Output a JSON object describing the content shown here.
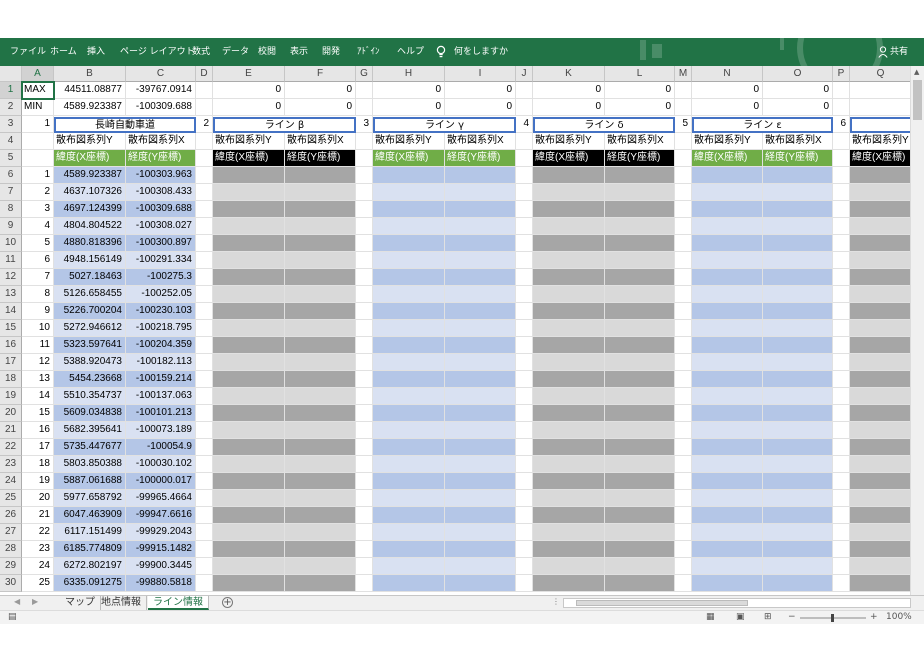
{
  "ribbon": {
    "tabs": [
      "ファイル",
      "ホーム",
      "挿入",
      "ページ レイアウト",
      "数式",
      "データ",
      "校閲",
      "表示",
      "開発",
      "ｱﾄﾞｲﾝ",
      "ヘルプ"
    ],
    "tell_me": "何をしますか",
    "share": "共有",
    "accent": "#217346"
  },
  "grid": {
    "columns": [
      "A",
      "B",
      "C",
      "D",
      "E",
      "F",
      "G",
      "H",
      "I",
      "J",
      "K",
      "L",
      "M",
      "N",
      "O",
      "P",
      "Q"
    ],
    "rows": [
      "1",
      "2",
      "3",
      "4",
      "5",
      "6",
      "7",
      "8",
      "9",
      "10",
      "11",
      "12",
      "13",
      "14",
      "15",
      "16",
      "17",
      "18",
      "19",
      "20",
      "21",
      "22",
      "23",
      "24",
      "25",
      "26",
      "27",
      "28",
      "29",
      "30"
    ],
    "max_row": {
      "label": "MAX",
      "b": "44511.08877",
      "c": "-39767.0914",
      "zeros": [
        "0",
        "0",
        "0",
        "0",
        "0",
        "0",
        "0",
        "0"
      ]
    },
    "min_row": {
      "label": "MIN",
      "b": "4589.923387",
      "c": "-100309.688",
      "zeros": [
        "0",
        "0",
        "0",
        "0",
        "0",
        "0",
        "0",
        "0"
      ]
    },
    "line_groups": [
      {
        "num": "1",
        "title": "長崎自動車道",
        "style": "bold-blue"
      },
      {
        "num": "2",
        "title": "ライン β",
        "style": "dark-grey"
      },
      {
        "num": "3",
        "title": "ライン γ",
        "style": "blue"
      },
      {
        "num": "4",
        "title": "ライン δ",
        "style": "dark-grey"
      },
      {
        "num": "5",
        "title": "ライン ε",
        "style": "blue"
      },
      {
        "num": "6",
        "title": "",
        "style": "dark-grey"
      }
    ],
    "series_y": "散布図系列Y",
    "series_x": "散布図系列X",
    "lat_label": "緯度(X座標)",
    "lon_label": "経度(Y座標)",
    "data_rows": [
      {
        "n": "1",
        "lat": "4589.923387",
        "lon": "-100303.963"
      },
      {
        "n": "2",
        "lat": "4637.107326",
        "lon": "-100308.433"
      },
      {
        "n": "3",
        "lat": "4697.124399",
        "lon": "-100309.688"
      },
      {
        "n": "4",
        "lat": "4804.804522",
        "lon": "-100308.027"
      },
      {
        "n": "5",
        "lat": "4880.818396",
        "lon": "-100300.897"
      },
      {
        "n": "6",
        "lat": "4948.156149",
        "lon": "-100291.334"
      },
      {
        "n": "7",
        "lat": "5027.18463",
        "lon": "-100275.3"
      },
      {
        "n": "8",
        "lat": "5126.658455",
        "lon": "-100252.05"
      },
      {
        "n": "9",
        "lat": "5226.700204",
        "lon": "-100230.103"
      },
      {
        "n": "10",
        "lat": "5272.946612",
        "lon": "-100218.795"
      },
      {
        "n": "11",
        "lat": "5323.597641",
        "lon": "-100204.359"
      },
      {
        "n": "12",
        "lat": "5388.920473",
        "lon": "-100182.113"
      },
      {
        "n": "13",
        "lat": "5454.23668",
        "lon": "-100159.214"
      },
      {
        "n": "14",
        "lat": "5510.354737",
        "lon": "-100137.063"
      },
      {
        "n": "15",
        "lat": "5609.034838",
        "lon": "-100101.213"
      },
      {
        "n": "16",
        "lat": "5682.395641",
        "lon": "-100073.189"
      },
      {
        "n": "17",
        "lat": "5735.447677",
        "lon": "-100054.9"
      },
      {
        "n": "18",
        "lat": "5803.850388",
        "lon": "-100030.102"
      },
      {
        "n": "19",
        "lat": "5887.061688",
        "lon": "-100000.017"
      },
      {
        "n": "20",
        "lat": "5977.658792",
        "lon": "-99965.4664"
      },
      {
        "n": "21",
        "lat": "6047.463909",
        "lon": "-99947.6616"
      },
      {
        "n": "22",
        "lat": "6117.151499",
        "lon": "-99929.2043"
      },
      {
        "n": "23",
        "lat": "6185.774809",
        "lon": "-99915.1482"
      },
      {
        "n": "24",
        "lat": "6272.802197",
        "lon": "-99900.3445"
      },
      {
        "n": "25",
        "lat": "6335.091275",
        "lon": "-99880.5818"
      }
    ]
  },
  "sheets": {
    "tabs": [
      "マップ",
      "地点情報",
      "ライン情報"
    ],
    "active": "ライン情報"
  },
  "status": {
    "zoom": "100%"
  }
}
